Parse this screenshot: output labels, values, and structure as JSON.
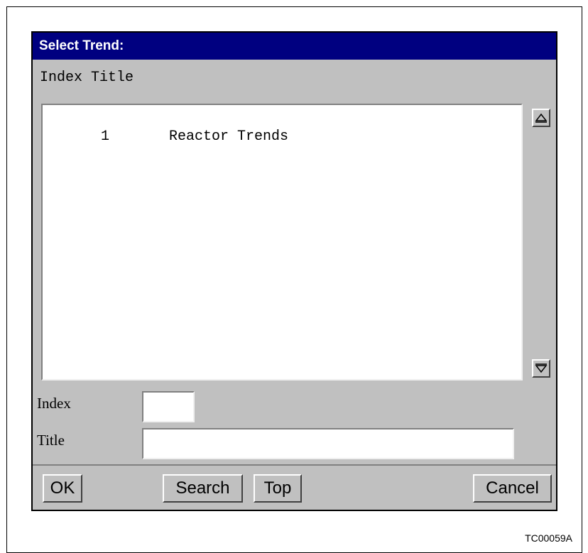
{
  "dialog": {
    "title": "Select Trend:",
    "column_headers": "Index Title",
    "list": {
      "items": [
        {
          "index": "1",
          "title": "Reactor Trends"
        }
      ]
    },
    "fields": {
      "index_label": "Index",
      "index_value": "",
      "title_label": "Title",
      "title_value": ""
    },
    "buttons": {
      "ok": "OK",
      "search": "Search",
      "top": "Top",
      "cancel": "Cancel"
    }
  },
  "figure_id": "TC00059A",
  "colors": {
    "titlebar": "#000080",
    "dialog_face": "#c0c0c0"
  }
}
